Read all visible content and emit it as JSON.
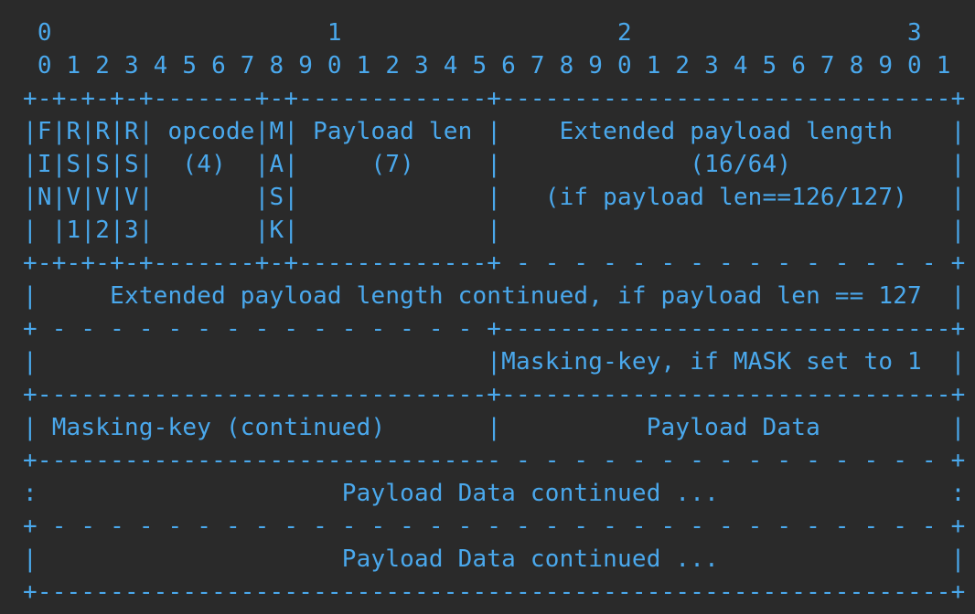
{
  "diagram": {
    "lines": [
      " 0                   1                   2                   3",
      " 0 1 2 3 4 5 6 7 8 9 0 1 2 3 4 5 6 7 8 9 0 1 2 3 4 5 6 7 8 9 0 1",
      "+-+-+-+-+-------+-+-------------+-------------------------------+",
      "|F|R|R|R| opcode|M| Payload len |    Extended payload length    |",
      "|I|S|S|S|  (4)  |A|     (7)     |             (16/64)           |",
      "|N|V|V|V|       |S|             |   (if payload len==126/127)   |",
      "| |1|2|3|       |K|             |                               |",
      "+-+-+-+-+-------+-+-------------+ - - - - - - - - - - - - - - - +",
      "|     Extended payload length continued, if payload len == 127  |",
      "+ - - - - - - - - - - - - - - - +-------------------------------+",
      "|                               |Masking-key, if MASK set to 1  |",
      "+-------------------------------+-------------------------------+",
      "| Masking-key (continued)       |          Payload Data         |",
      "+-------------------------------- - - - - - - - - - - - - - - - +",
      ":                     Payload Data continued ...                :",
      "+ - - - - - - - - - - - - - - - - - - - - - - - - - - - - - - - +",
      "|                     Payload Data continued ...                |",
      "+---------------------------------------------------------------+"
    ]
  }
}
